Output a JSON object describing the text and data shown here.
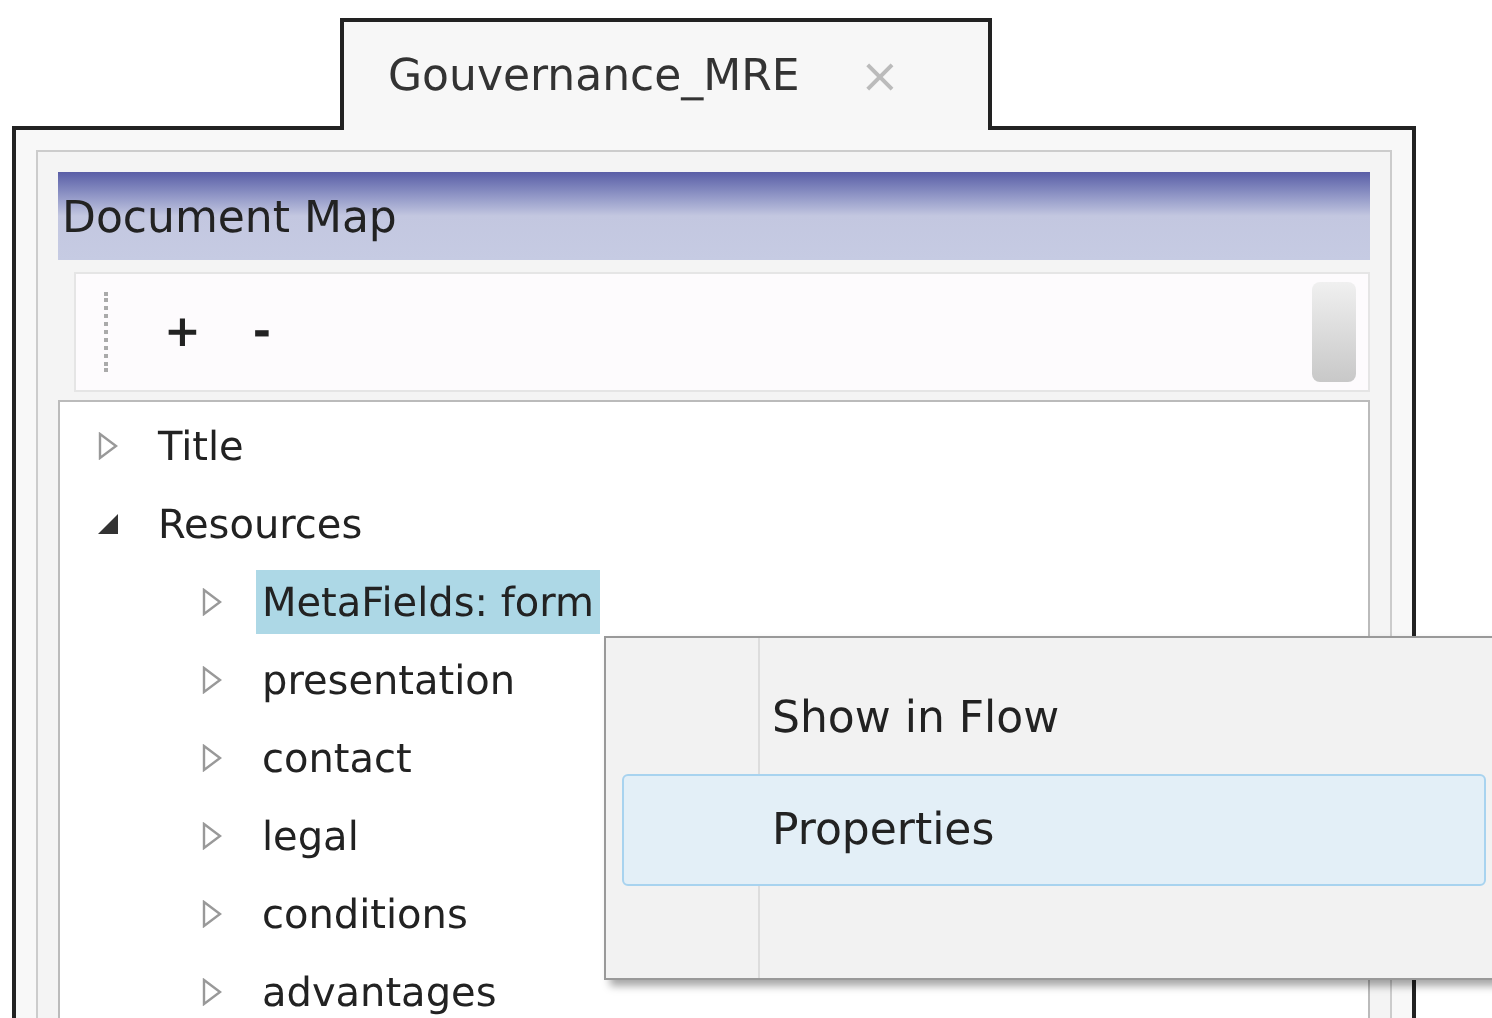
{
  "tab": {
    "title": "Gouvernance_MRE",
    "close": "×"
  },
  "panel": {
    "title": "Document Map"
  },
  "toolbar": {
    "buttons": [
      "+",
      "-"
    ]
  },
  "tree": [
    {
      "label": "Title",
      "expanded": false,
      "selected": false
    },
    {
      "label": "Resources",
      "expanded": true,
      "selected": false,
      "children": [
        {
          "label": "MetaFields: form",
          "expanded": false,
          "selected": true
        },
        {
          "label": "presentation",
          "expanded": false,
          "selected": false
        },
        {
          "label": "contact",
          "expanded": false,
          "selected": false
        },
        {
          "label": "legal",
          "expanded": false,
          "selected": false
        },
        {
          "label": "conditions",
          "expanded": false,
          "selected": false
        },
        {
          "label": "advantages",
          "expanded": false,
          "selected": false
        }
      ]
    }
  ],
  "context_menu": [
    {
      "label": "Show in Flow",
      "selected": false
    },
    {
      "label": "Properties",
      "selected": true
    }
  ]
}
